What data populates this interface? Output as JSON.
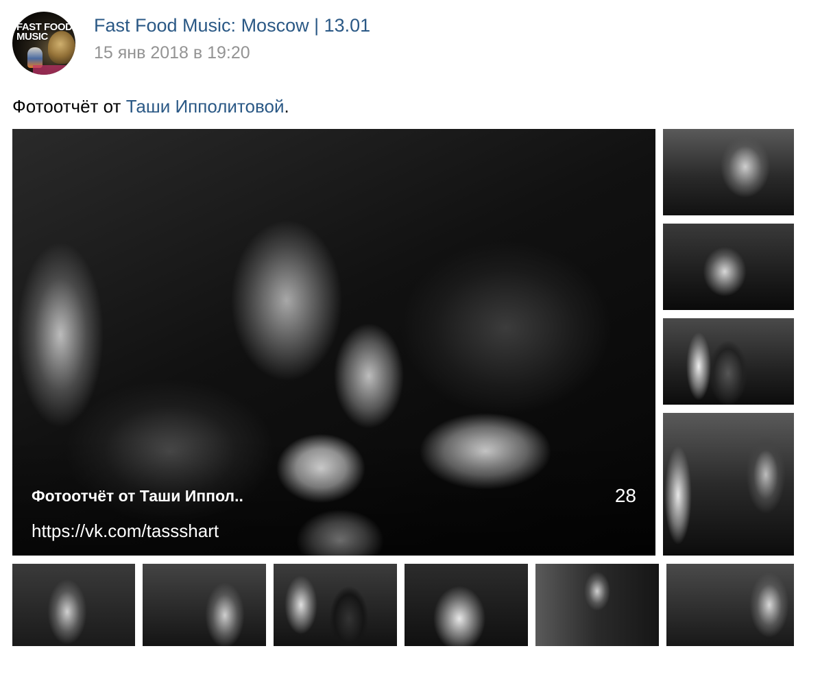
{
  "post": {
    "author": "Fast Food Music: Moscow | 13.01",
    "date": "15 янв 2018 в 19:20",
    "avatar_text": "FAST FOOD\nMUSIC",
    "text_before": "Фотоотчёт от ",
    "text_link": "Таши Ипполитовой",
    "text_after": "."
  },
  "album": {
    "title": "Фотоотчёт от Таши Иппол..",
    "count": "28",
    "link": "https://vk.com/tassshart"
  },
  "colors": {
    "link": "#2a5885",
    "meta": "#939393",
    "text": "#000000"
  }
}
